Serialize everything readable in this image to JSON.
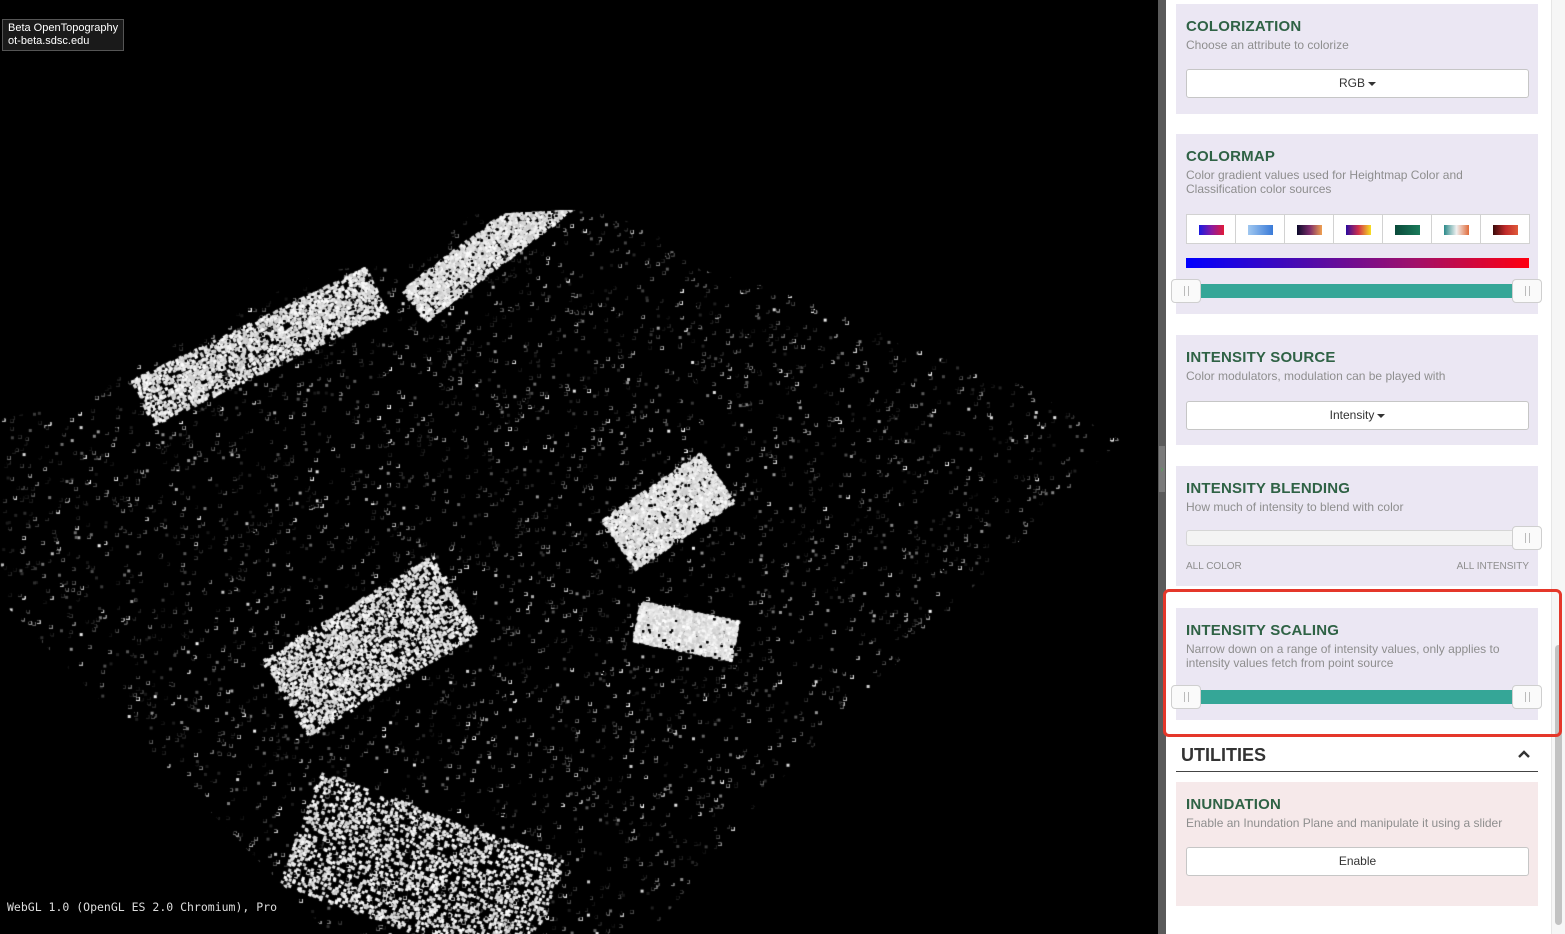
{
  "viewer": {
    "badge_line1": "Beta OpenTopography",
    "badge_line2": "ot-beta.sdsc.edu",
    "webgl_info": "WebGL 1.0 (OpenGL ES 2.0 Chromium), Pro"
  },
  "colorization": {
    "title": "COLORIZATION",
    "description": "Choose an attribute to colorize",
    "selected": "RGB"
  },
  "colormap": {
    "title": "COLORMAP",
    "description": "Color gradient values used for Heightmap Color and Classification color sources",
    "swatches": [
      {
        "name": "blue-red",
        "colors": [
          "#1a1ae0",
          "#8a1aa0",
          "#e01a3a"
        ]
      },
      {
        "name": "blues",
        "colors": [
          "#a0c8f0",
          "#3a7ad8"
        ]
      },
      {
        "name": "magma",
        "colors": [
          "#0a0a2a",
          "#7a2a6a",
          "#f0a050"
        ]
      },
      {
        "name": "plasma",
        "colors": [
          "#2a0aa0",
          "#d0304a",
          "#f8e020"
        ]
      },
      {
        "name": "teal-dark",
        "colors": [
          "#0a4a3a",
          "#1a7a5a"
        ]
      },
      {
        "name": "teal-orange",
        "colors": [
          "#2a8a8a",
          "#f0f0f0",
          "#e06a3a"
        ]
      },
      {
        "name": "red-dark",
        "colors": [
          "#3a0a0a",
          "#c02a2a",
          "#e05a3a"
        ]
      }
    ],
    "gradient": [
      "#0000ff",
      "#4a0ab0",
      "#a0106a",
      "#ff0010"
    ],
    "range": [
      0,
      1
    ]
  },
  "intensity_source": {
    "title": "INTENSITY SOURCE",
    "description": "Color modulators, modulation can be played with",
    "selected": "Intensity"
  },
  "intensity_blending": {
    "title": "INTENSITY BLENDING",
    "description": "How much of intensity to blend with color",
    "value": 1.0,
    "label_left": "ALL COLOR",
    "label_right": "ALL INTENSITY"
  },
  "intensity_scaling": {
    "title": "INTENSITY SCALING",
    "description": "Narrow down on a range of intensity values, only applies to intensity values fetch from point source",
    "range": [
      0,
      1
    ]
  },
  "utilities": {
    "header": "UTILITIES",
    "inundation": {
      "title": "INUNDATION",
      "description": "Enable an Inundation Plane and manipulate it using a slider",
      "button": "Enable"
    }
  },
  "colors": {
    "accent_teal": "#35a697",
    "heading_green": "#2f6245",
    "highlight_red": "#e5372a"
  }
}
